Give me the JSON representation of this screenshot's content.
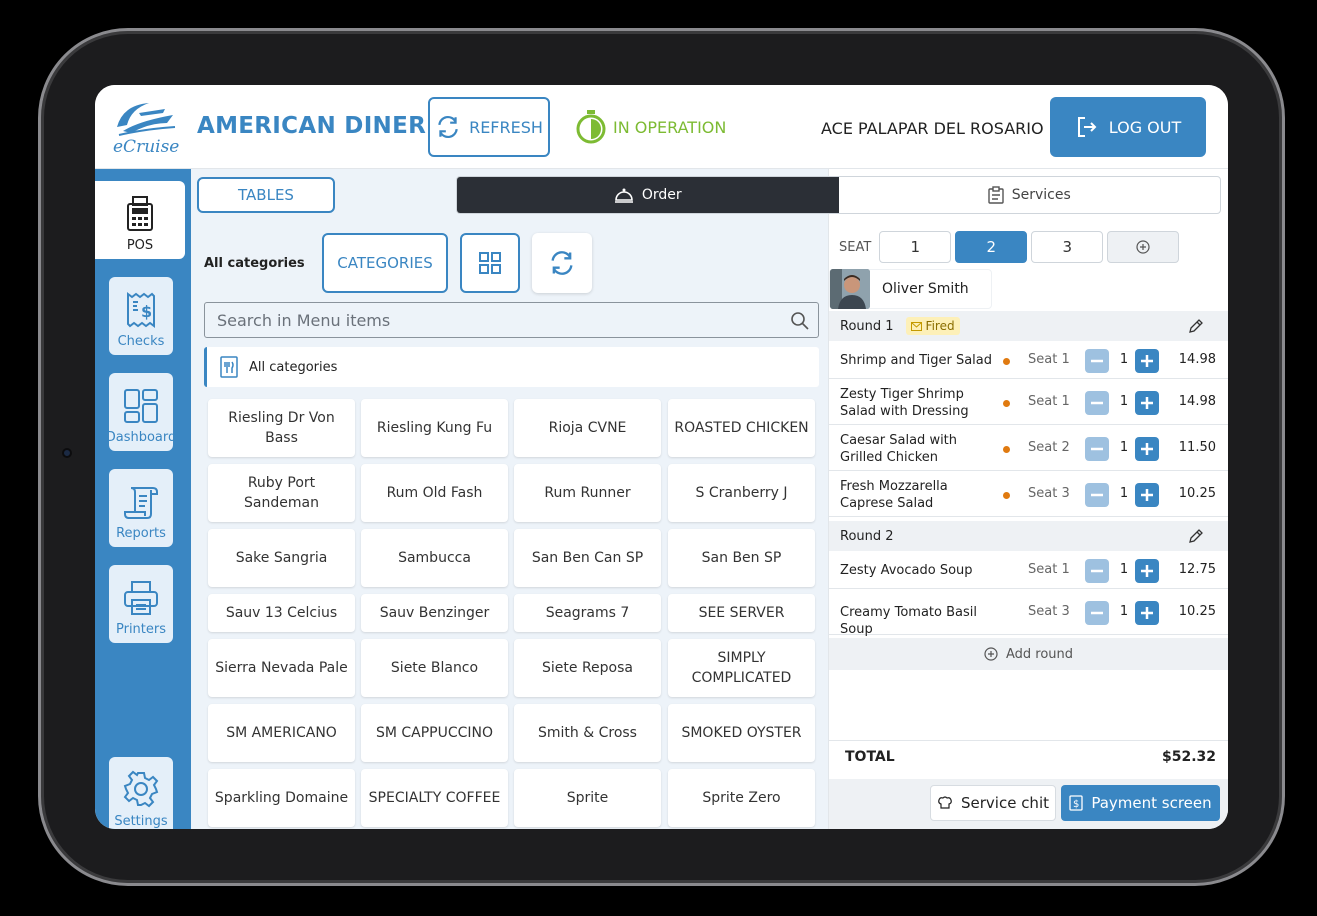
{
  "app": {
    "logo_text": "eCruise",
    "restaurant_name": "AMERICAN DINER",
    "refresh_label": "REFRESH",
    "status_label": "IN OPERATION",
    "user_name": "ACE PALAPAR DEL ROSARIO",
    "logout_label": "LOG OUT",
    "brand_color": "#3a86c2",
    "status_color": "#7dbb33"
  },
  "sidebar": {
    "items": [
      {
        "label": "POS",
        "icon": "pos-terminal-icon",
        "active": true
      },
      {
        "label": "Checks",
        "icon": "receipt-icon",
        "active": false
      },
      {
        "label": "Dashboard",
        "icon": "dashboard-icon",
        "active": false
      },
      {
        "label": "Reports",
        "icon": "scroll-icon",
        "active": false
      },
      {
        "label": "Printers",
        "icon": "printer-icon",
        "active": false
      },
      {
        "label": "Settings",
        "icon": "gear-icon",
        "active": false
      }
    ]
  },
  "menu": {
    "tables_label": "TABLES",
    "filter_label": "All categories",
    "categories_label": "CATEGORIES",
    "search_placeholder": "Search in Menu items",
    "category_strip_label": "All categories",
    "items": [
      "Riesling Dr Von Bass",
      "Riesling Kung Fu",
      "Rioja CVNE",
      "ROASTED CHICKEN",
      "Ruby Port Sandeman",
      "Rum Old Fash",
      "Rum Runner",
      "S Cranberry J",
      "Sake Sangria",
      "Sambucca",
      "San Ben Can SP",
      "San Ben SP",
      "Sauv 13 Celcius",
      "Sauv Benzinger",
      "Seagrams 7",
      "SEE SERVER",
      "Sierra Nevada Pale",
      "Siete Blanco",
      "Siete Reposa",
      "SIMPLY COMPLICATED",
      "SM AMERICANO",
      "SM CAPPUCCINO",
      "Smith & Cross",
      "SMOKED OYSTER",
      "Sparkling Domaine",
      "SPECIALTY COFFEE",
      "Sprite",
      "Sprite Zero"
    ]
  },
  "order": {
    "tabs": [
      {
        "label": "Order",
        "icon": "cloche-icon",
        "active": true
      },
      {
        "label": "Services",
        "icon": "clipboard-icon",
        "active": false
      }
    ],
    "seat_label": "SEAT",
    "seats": [
      "1",
      "2",
      "3"
    ],
    "active_seat": "2",
    "guest_name": "Oliver Smith",
    "rounds": [
      {
        "title": "Round 1",
        "badge": "Fired",
        "lines": [
          {
            "name": "Shrimp and Tiger Salad",
            "seat": "Seat 1",
            "qty": "1",
            "price": "14.98",
            "fired": true
          },
          {
            "name": "Zesty Tiger Shrimp Salad with Dressing",
            "seat": "Seat 1",
            "qty": "1",
            "price": "14.98",
            "fired": true
          },
          {
            "name": "Caesar Salad with Grilled Chicken",
            "seat": "Seat 2",
            "qty": "1",
            "price": "11.50",
            "fired": true
          },
          {
            "name": "Fresh Mozzarella Caprese Salad",
            "seat": "Seat 3",
            "qty": "1",
            "price": "10.25",
            "fired": true
          }
        ]
      },
      {
        "title": "Round 2",
        "badge": "",
        "lines": [
          {
            "name": "Zesty Avocado Soup",
            "seat": "Seat 1",
            "qty": "1",
            "price": "12.75",
            "fired": false
          },
          {
            "name": "Creamy Tomato Basil Soup",
            "seat": "Seat 3",
            "qty": "1",
            "price": "10.25",
            "fired": false
          }
        ]
      }
    ],
    "add_round_label": "Add round",
    "total_label": "TOTAL",
    "total_value": "$52.32",
    "service_chit_label": "Service chit",
    "payment_label": "Payment screen"
  }
}
